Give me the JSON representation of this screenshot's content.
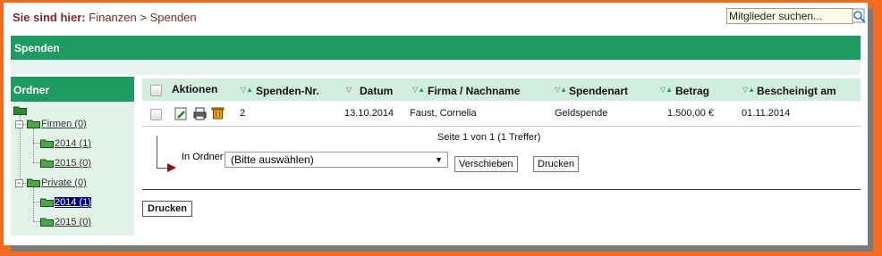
{
  "breadcrumb": {
    "prefix": "Sie sind hier:",
    "items": [
      "Finanzen",
      "Spenden"
    ],
    "separator": ">"
  },
  "search": {
    "value": "Mitglieder suchen...",
    "icon": "search-icon"
  },
  "page_title": "Spenden",
  "sidebar": {
    "title": "Ordner",
    "tree": [
      {
        "label": "Firmen (0)",
        "children": [
          {
            "label": "2014 (1)"
          },
          {
            "label": "2015 (0)"
          }
        ]
      },
      {
        "label": "Private (0)",
        "children": [
          {
            "label": "2014 (1)",
            "selected": true
          },
          {
            "label": "2015 (0)"
          }
        ]
      }
    ]
  },
  "table": {
    "columns": [
      "Aktionen",
      "Spenden-Nr.",
      "Datum",
      "Firma / Nachname",
      "Spendenart",
      "Betrag",
      "Bescheinigt am"
    ],
    "sort_icons": {
      "default": "▽▲",
      "active": "▽"
    },
    "rows": [
      {
        "nr": "2",
        "datum": "13.10.2014",
        "name": "Faust, Cornelia",
        "art": "Geldspende",
        "betrag": "1.500,00 €",
        "bescheinigt": "01.11.2014"
      }
    ]
  },
  "pager": "Seite 1 von 1 (1 Treffer)",
  "move": {
    "label": "In Ordner",
    "select_value": "(Bitte auswählen)",
    "move_button": "Verschieben",
    "print_button": "Drucken"
  },
  "bottom_print_button": "Drucken",
  "colors": {
    "accent_green": "#1e9a62",
    "header_bg": "#d2ede0",
    "frame_orange": "#f36b21",
    "breadcrumb": "#7a2a2a"
  }
}
